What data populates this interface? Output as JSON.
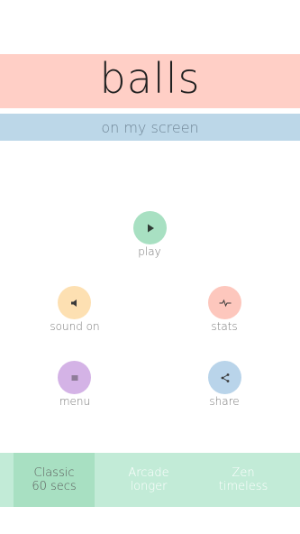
{
  "title": "balls",
  "subtitle": "on my screen",
  "buttons": {
    "play": {
      "label": "play",
      "icon": "play-icon"
    },
    "sound": {
      "label": "sound on",
      "icon": "speaker-icon"
    },
    "stats": {
      "label": "stats",
      "icon": "pulse-icon"
    },
    "menu": {
      "label": "menu",
      "icon": "hamburger-icon"
    },
    "share": {
      "label": "share",
      "icon": "share-icon"
    }
  },
  "modes": [
    {
      "name": "Classic",
      "desc": "60 secs",
      "selected": true
    },
    {
      "name": "Arcade",
      "desc": "longer",
      "selected": false
    },
    {
      "name": "Zen",
      "desc": "timeless",
      "selected": false
    }
  ],
  "colors": {
    "title_band": "#ffcfc6",
    "subtitle_band": "#bcd7e8",
    "play": "#a8e0c2",
    "sound": "#fde0b2",
    "stats": "#fdc7bd",
    "menu": "#d4b3e6",
    "share": "#b9d4ea",
    "mode_bar": "#c2ebd7",
    "mode_selected": "#a8e0c2"
  }
}
